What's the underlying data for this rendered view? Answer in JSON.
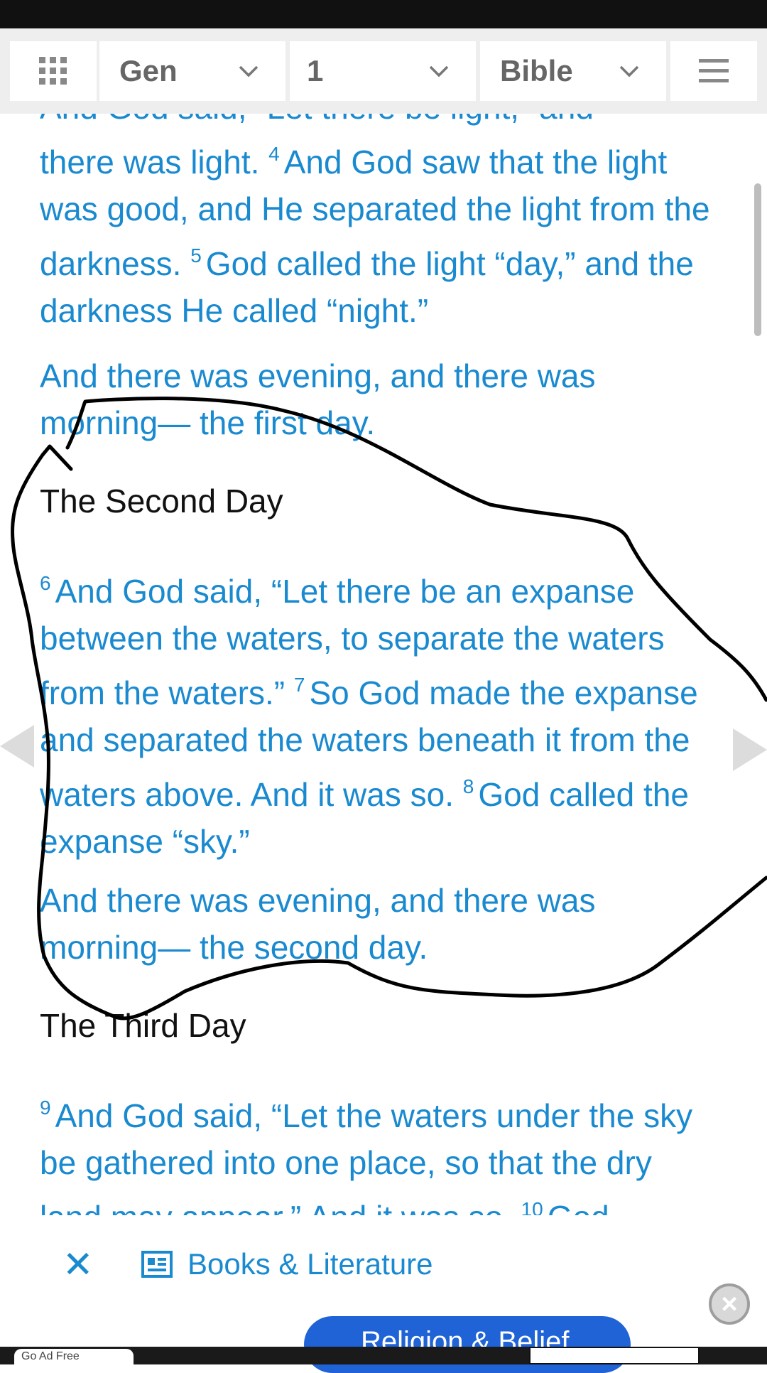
{
  "toolbar": {
    "book": "Gen",
    "chapter": "1",
    "version": "Bible"
  },
  "content": {
    "cut_line": "And God said, “Let there be light,” and",
    "p1": {
      "lead": "there was light.",
      "v4": "4",
      "t4": "And God saw that the light was good, and He separated the light from the darkness.",
      "v5": "5",
      "t5": "God called the light “day,” and the darkness He called “night.”"
    },
    "p2": "And there was evening, and there was morning— the first day.",
    "heading2": "The Second Day",
    "p3": {
      "v6": "6",
      "t6": "And God said, “Let there be an expanse between the waters, to separate the waters from the waters.”",
      "v7": "7",
      "t7": "So God made the expanse and separated the waters beneath it from the waters above. And it was so.",
      "v8": "8",
      "t8": "God called the expanse “sky.”"
    },
    "p4": "And there was evening, and there was morning— the second day.",
    "heading3": "The Third Day",
    "p5": {
      "v9": "9",
      "t9": "And God said, “Let the waters under the sky be gathered into one place, so that the dry land may appear.” And it was so.",
      "v10": "10",
      "t10": "God"
    }
  },
  "ad": {
    "close": "✕",
    "topic": "Books & Literature",
    "pill": "Religion & Belief",
    "label": "Go Ad Free"
  },
  "colors": {
    "text_blue": "#1a8ad0",
    "scribble": "#000000",
    "pill_blue": "#1f63d6"
  }
}
